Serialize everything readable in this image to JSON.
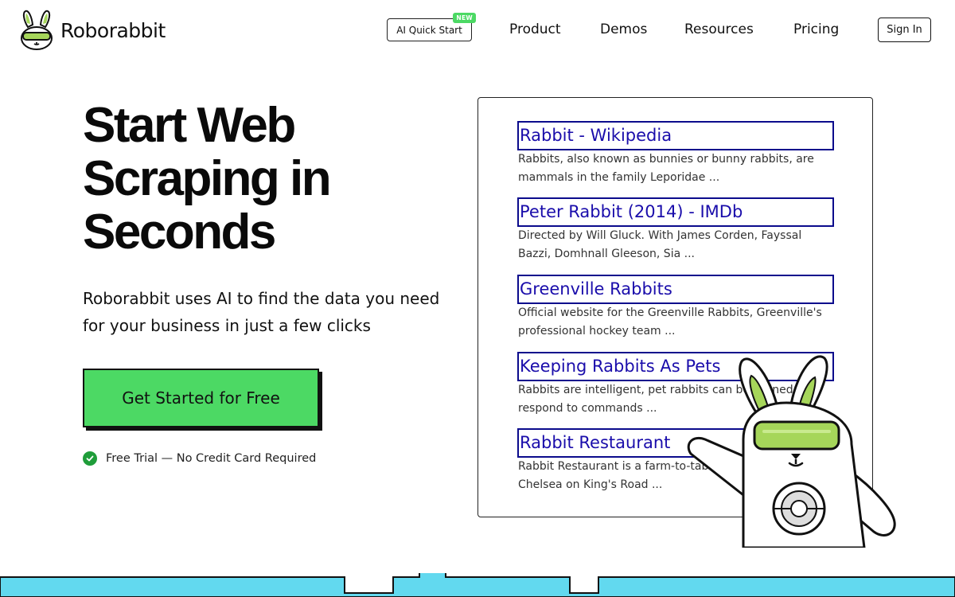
{
  "brand": {
    "name": "Roborabbit"
  },
  "nav": {
    "quick_start": "AI Quick Start",
    "new_badge": "NEW",
    "links": [
      "Product",
      "Demos",
      "Resources",
      "Pricing"
    ],
    "sign_in": "Sign In"
  },
  "hero": {
    "title_lines": [
      "Start Web",
      "Scraping in",
      "Seconds"
    ],
    "subtitle": "Roborabbit uses AI to find the data you need for your business in just a few clicks",
    "cta": "Get Started for Free",
    "trial_note": "Free Trial — No Credit Card Required"
  },
  "results": [
    {
      "title": "Rabbit - Wikipedia",
      "desc_lines": [
        "Rabbits, also known as bunnies or bunny rabbits, are",
        "mammals in the family Leporidae ..."
      ]
    },
    {
      "title": "Peter Rabbit (2014) - IMDb",
      "desc_lines": [
        "Directed by Will Gluck. With James Corden, Fayssal",
        "Bazzi, Domhnall Gleeson, Sia ..."
      ]
    },
    {
      "title": "Greenville Rabbits",
      "desc_lines": [
        "Official website for the Greenville Rabbits, Greenville's",
        "professional hockey team ..."
      ]
    },
    {
      "title": "Keeping Rabbits As Pets",
      "desc_lines": [
        "Rabbits are intelligent, pet rabbits can be trained to",
        "respond to commands ..."
      ]
    },
    {
      "title": "Rabbit Restaurant",
      "desc_lines": [
        "Rabbit Restaurant is a farm-to-table restaurant in",
        "Chelsea on King's Road ..."
      ]
    }
  ],
  "colors": {
    "accent_green": "#4cd964",
    "check_green": "#1f9d3a",
    "link_blue": "#1a0dab",
    "link_border": "#0b0b8c",
    "band_cyan": "#62d9ef",
    "visor_green": "#a6d65a"
  }
}
